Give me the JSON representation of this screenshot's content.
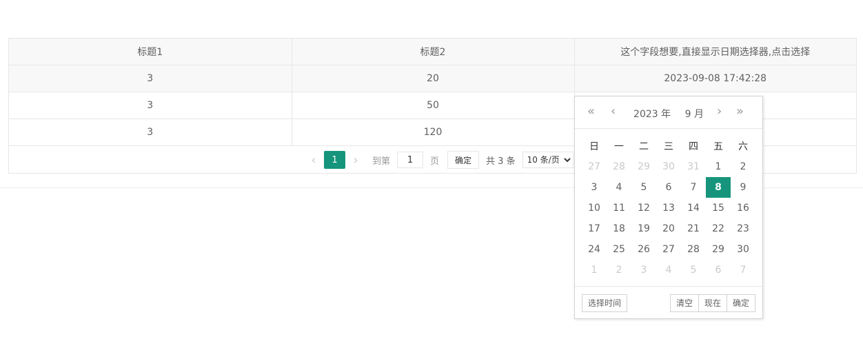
{
  "table": {
    "headers": [
      "标题1",
      "标题2",
      "这个字段想要,直接显示日期选择器,点击选择"
    ],
    "rows": [
      [
        "3",
        "20",
        "2023-09-08 17:42:28"
      ],
      [
        "3",
        "50",
        ""
      ],
      [
        "3",
        "120",
        ""
      ]
    ]
  },
  "pager": {
    "prev_icon": "‹",
    "next_icon": "›",
    "current_page": "1",
    "goto_label": "到第",
    "goto_value": "1",
    "page_unit": "页",
    "confirm_label": "确定",
    "count_label": "共 3 条",
    "limit_selected": "10 条/页",
    "accent": "#16957c"
  },
  "picker": {
    "prev_year_icon": "«",
    "prev_month_icon": "‹",
    "next_month_icon": "›",
    "next_year_icon": "»",
    "year_label": "2023 年",
    "month_label": "9 月",
    "weekdays": [
      "日",
      "一",
      "二",
      "三",
      "四",
      "五",
      "六"
    ],
    "weeks": [
      [
        "27",
        "28",
        "29",
        "30",
        "31",
        "1",
        "2"
      ],
      [
        "3",
        "4",
        "5",
        "6",
        "7",
        "8",
        "9"
      ],
      [
        "10",
        "11",
        "12",
        "13",
        "14",
        "15",
        "16"
      ],
      [
        "17",
        "18",
        "19",
        "20",
        "21",
        "22",
        "23"
      ],
      [
        "24",
        "25",
        "26",
        "27",
        "28",
        "29",
        "30"
      ],
      [
        "1",
        "2",
        "3",
        "4",
        "5",
        "6",
        "7"
      ]
    ],
    "selected_day": "8",
    "select_time_label": "选择时间",
    "clear_label": "清空",
    "now_label": "现在",
    "confirm_label": "确定"
  }
}
